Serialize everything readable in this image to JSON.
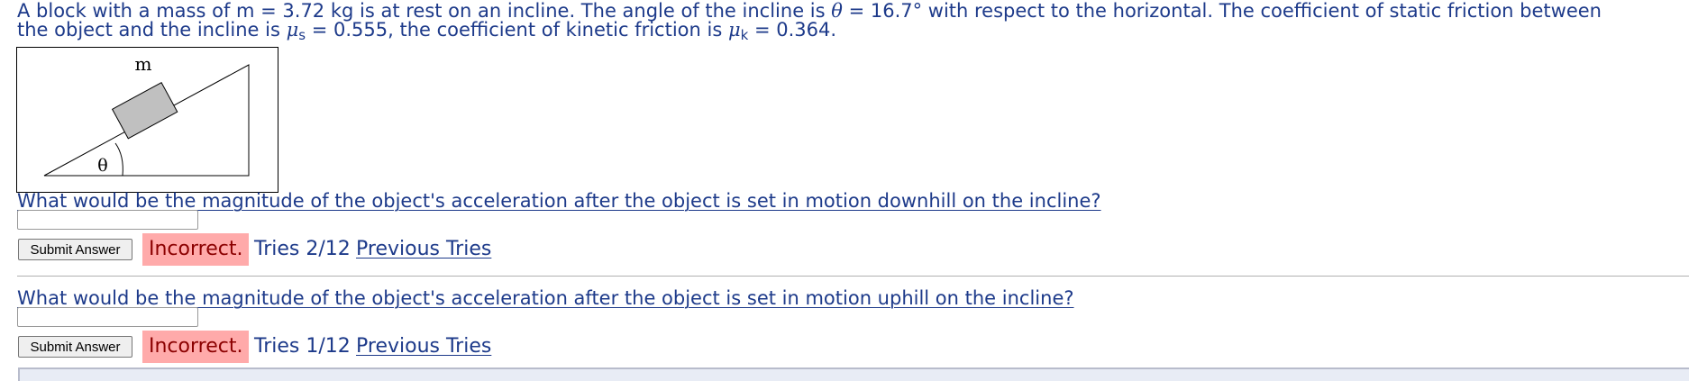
{
  "problem": {
    "line1": "A block with a mass of m = 3.72 kg is at rest on an incline. The angle of the incline is ",
    "theta_symbol": "θ",
    "line1_after_theta": " = 16.7° with respect to the horizontal. The coefficient of static friction between",
    "line2_pre": "the object and the incline is ",
    "mu_symbol": "μ",
    "mu_s_sub": "s",
    "line2_mid": " = 0.555, the coefficient of kinetic friction is ",
    "mu_k_sub": "k",
    "line2_end": " = 0.364."
  },
  "figure": {
    "mass_label": "m",
    "angle_label": "θ"
  },
  "questions": [
    {
      "text": "What would be the magnitude of the object's acceleration after the object is set in motion downhill on the incline?",
      "answer_value": "",
      "submit_label": "Submit Answer",
      "status": "Incorrect.",
      "tries": "Tries 2/12",
      "previous_tries": "Previous Tries"
    },
    {
      "text": "What would be the magnitude of the object's acceleration after the object is set in motion uphill on the incline?",
      "answer_value": "",
      "submit_label": "Submit Answer",
      "status": "Incorrect.",
      "tries": "Tries 1/12",
      "previous_tries": "Previous Tries"
    }
  ],
  "colors": {
    "text": "#1d3a8a",
    "incorrect_bg": "#ffaaaa",
    "incorrect_text": "#8b0000"
  }
}
